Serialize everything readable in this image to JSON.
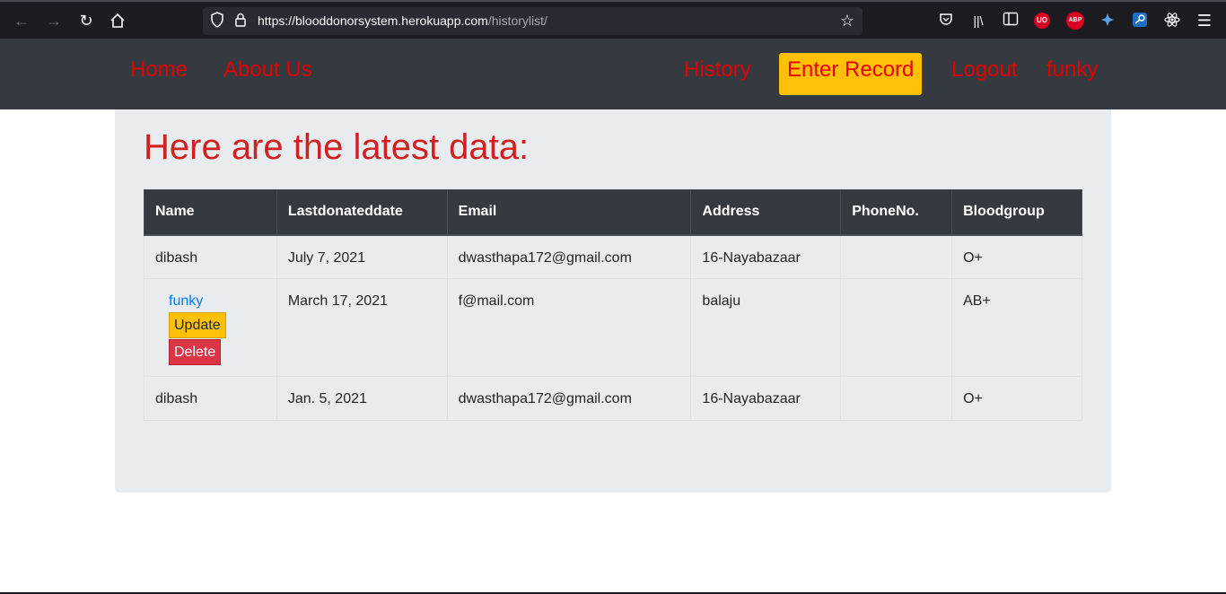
{
  "browser": {
    "url_host": "https://blooddonorsystem.herokuapp.com",
    "url_path": "/historylist/",
    "icons": [
      "back-icon",
      "forward-icon",
      "reload-icon",
      "home-icon",
      "shield-icon",
      "lock-icon",
      "bookmark-star-icon",
      "pocket-icon",
      "library-icon",
      "sidebar-icon",
      "ublock-icon",
      "adblock-plus-icon",
      "extension-icon",
      "steam-icon",
      "react-devtools-icon",
      "menu-icon"
    ],
    "ublock_label": "UO",
    "abp_label": "ABP"
  },
  "nav": {
    "home": "Home",
    "about": "About Us",
    "history": "History",
    "enter_record": "Enter Record",
    "logout": "Logout",
    "user": "funky"
  },
  "colors": {
    "nav_bg": "#343a40",
    "nav_link": "#e60000",
    "enter_bg": "#ffc107",
    "title": "#d21f1f",
    "jumbo_bg": "#e9ecef"
  },
  "main": {
    "title": "Here are the latest data:",
    "columns": [
      "Name",
      "Lastdonateddate",
      "Email",
      "Address",
      "PhoneNo.",
      "Bloodgroup"
    ],
    "rows": [
      {
        "name": "dibash",
        "date": "July 7, 2021",
        "email": "dwasthapa172@gmail.com",
        "address": "16-Nayabazaar",
        "phone": "",
        "bloodgroup": "O+"
      },
      {
        "name": "funky",
        "date": "March 17, 2021",
        "email": "f@mail.com",
        "address": "balaju",
        "phone": "",
        "bloodgroup": "AB+",
        "update_label": "Update",
        "delete_label": "Delete"
      },
      {
        "name": "dibash",
        "date": "Jan. 5, 2021",
        "email": "dwasthapa172@gmail.com",
        "address": "16-Nayabazaar",
        "phone": "",
        "bloodgroup": "O+"
      }
    ]
  }
}
